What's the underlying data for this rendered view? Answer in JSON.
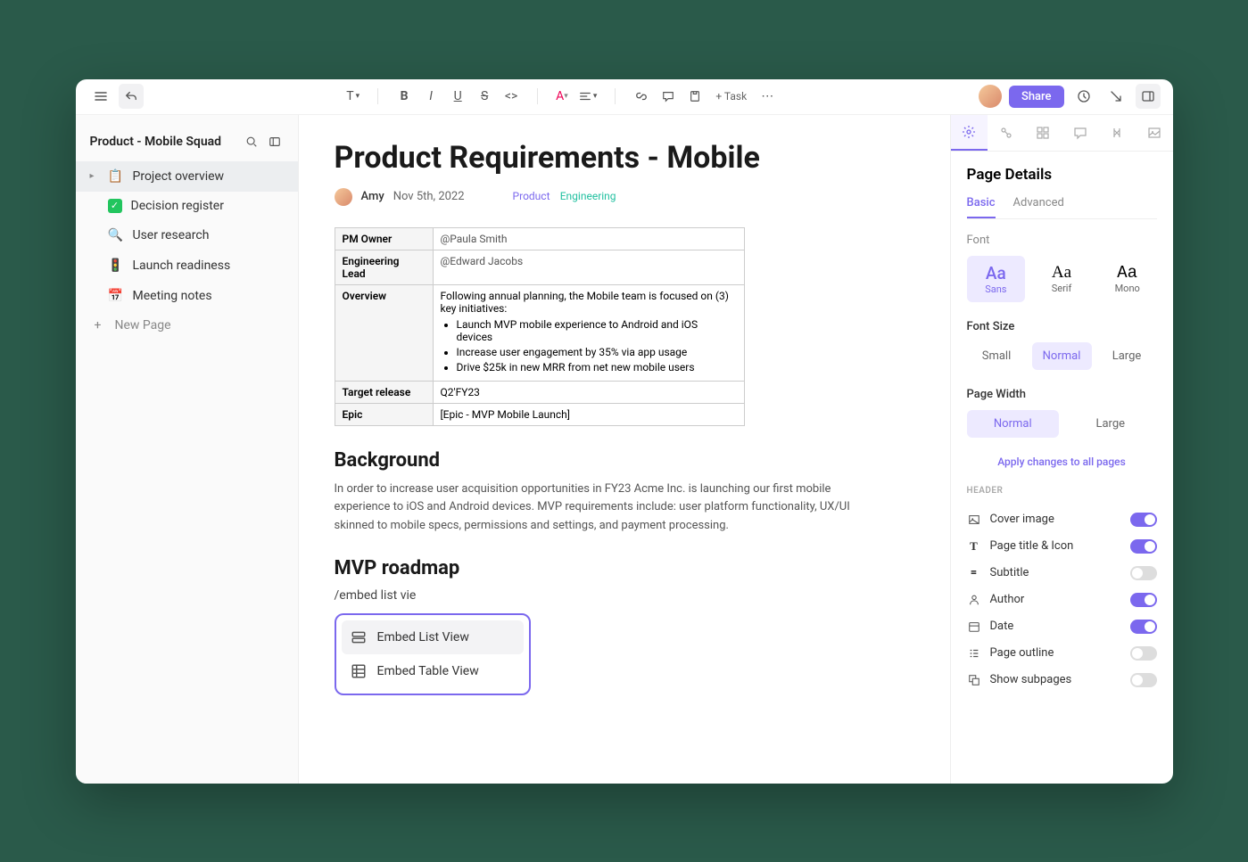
{
  "sidebar": {
    "title": "Product - Mobile Squad",
    "items": [
      {
        "label": "Project overview",
        "icon": "📋",
        "selected": true,
        "caret": true
      },
      {
        "label": "Decision register",
        "icon": "check"
      },
      {
        "label": "User research",
        "icon": "🔍"
      },
      {
        "label": "Launch readiness",
        "icon": "🚦"
      },
      {
        "label": "Meeting notes",
        "icon": "📅"
      }
    ],
    "new_page": "New Page"
  },
  "toolbar": {
    "task": "+ Task",
    "share": "Share"
  },
  "page": {
    "title": "Product Requirements - Mobile",
    "author": "Amy",
    "date": "Nov 5th, 2022",
    "tags": [
      {
        "label": "Product",
        "class": "product"
      },
      {
        "label": "Engineering",
        "class": "eng"
      }
    ],
    "table": {
      "pm_owner_label": "PM Owner",
      "pm_owner_value": "@Paula Smith",
      "eng_lead_label": "Engineering Lead",
      "eng_lead_value": "@Edward Jacobs",
      "overview_label": "Overview",
      "overview_intro": "Following annual planning, the Mobile team is focused on (3) key initiatives:",
      "overview_items": [
        "Launch MVP mobile experience to Android and iOS devices",
        "Increase user engagement by 35% via app usage",
        "Drive $25k in new MRR from net new mobile users"
      ],
      "target_label": "Target release",
      "target_value": "Q2'FY23",
      "epic_label": "Epic",
      "epic_value": "[Epic - MVP Mobile Launch]"
    },
    "background_heading": "Background",
    "background_body": "In order to increase user acquisition opportunities in FY23 Acme Inc. is launching our first mobile experience to iOS and Android devices. MVP requirements include: user platform functionality, UX/UI skinned to mobile specs, permissions and settings, and payment processing.",
    "roadmap_heading": "MVP roadmap",
    "slash_text": "/embed list vie",
    "slash_menu": [
      {
        "label": "Embed List View",
        "icon": "list",
        "selected": true
      },
      {
        "label": "Embed Table View",
        "icon": "table"
      }
    ]
  },
  "rightpanel": {
    "title": "Page Details",
    "subtabs": {
      "basic": "Basic",
      "advanced": "Advanced"
    },
    "font_label": "Font",
    "fonts": [
      {
        "aa": "Aa",
        "name": "Sans",
        "active": true
      },
      {
        "aa": "Aa",
        "name": "Serif"
      },
      {
        "aa": "Aa",
        "name": "Mono"
      }
    ],
    "fontsize_label": "Font Size",
    "fontsizes": [
      {
        "label": "Small"
      },
      {
        "label": "Normal",
        "active": true
      },
      {
        "label": "Large"
      }
    ],
    "pagewidth_label": "Page Width",
    "pagewidths": [
      {
        "label": "Normal",
        "active": true
      },
      {
        "label": "Large"
      }
    ],
    "apply_all": "Apply changes to all pages",
    "header_section": "HEADER",
    "toggles": [
      {
        "label": "Cover image",
        "icon": "image",
        "on": true
      },
      {
        "label": "Page title & Icon",
        "icon": "T",
        "on": true
      },
      {
        "label": "Subtitle",
        "icon": "=",
        "on": false
      },
      {
        "label": "Author",
        "icon": "person",
        "on": true
      },
      {
        "label": "Date",
        "icon": "calendar",
        "on": true
      },
      {
        "label": "Page outline",
        "icon": "outline",
        "on": false
      },
      {
        "label": "Show subpages",
        "icon": "subpages",
        "on": false
      }
    ]
  }
}
